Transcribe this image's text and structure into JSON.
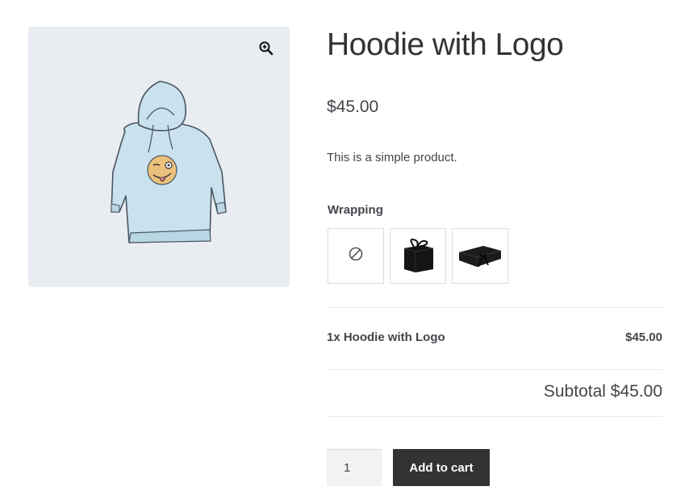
{
  "product": {
    "title": "Hoodie with Logo",
    "price": "$45.00",
    "description": "This is a simple product."
  },
  "gallery": {
    "zoom_icon": "zoom-in-icon",
    "image": "hoodie-with-logo-illustration"
  },
  "wrapping": {
    "label": "Wrapping",
    "options": [
      {
        "name": "none",
        "icon": "no-wrap-icon"
      },
      {
        "name": "black-gift-box-with-bow",
        "icon": "gift-box-icon"
      },
      {
        "name": "black-magnetic-gift-box",
        "icon": "gift-box-flat-icon"
      }
    ]
  },
  "summary": {
    "line_item": "1x Hoodie with Logo",
    "line_price": "$45.00",
    "subtotal": "Subtotal $45.00"
  },
  "cart": {
    "quantity": "1",
    "add_label": "Add to cart"
  },
  "colors": {
    "button_bg": "#333333",
    "gallery_bg": "#e9ecf1",
    "text": "#43454b"
  }
}
